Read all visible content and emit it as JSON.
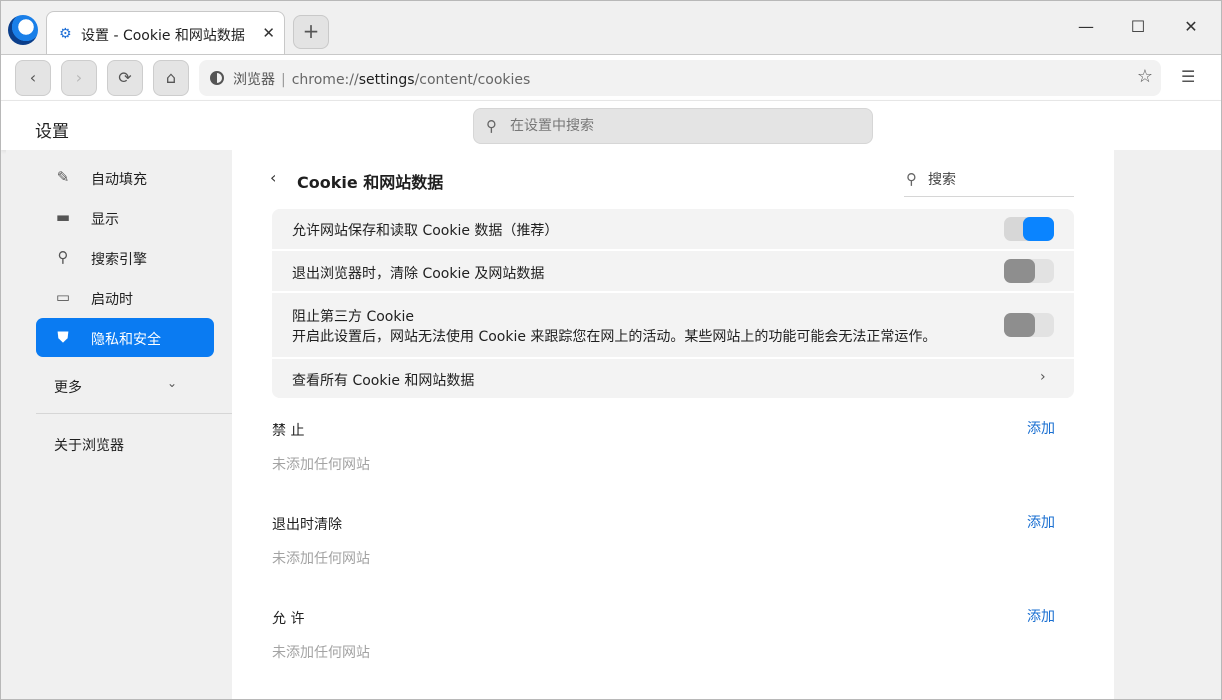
{
  "tab": {
    "title": "设置 - Cookie 和网站数据",
    "close": "✕"
  },
  "new_tab_label": "+",
  "window_controls": {
    "minimize": "—",
    "maximize": "☐",
    "close": "✕"
  },
  "toolbar": {
    "back": "‹",
    "forward": "›",
    "reload": "⟳",
    "home": "⌂",
    "omnibox": {
      "label": "浏览器",
      "separator": "|",
      "url_scheme": "chrome://",
      "url_host": "settings",
      "url_path": "/content/cookies"
    },
    "star": "☆",
    "menu": "☰"
  },
  "settings": {
    "title": "设置",
    "search_placeholder": "在设置中搜索"
  },
  "sidebar": {
    "items": [
      {
        "label": "自动填充",
        "icon": "pencil-icon",
        "glyph": "✎"
      },
      {
        "label": "显示",
        "icon": "monitor-icon",
        "glyph": "▬"
      },
      {
        "label": "搜索引擎",
        "icon": "search-icon",
        "glyph": "⚲"
      },
      {
        "label": "启动时",
        "icon": "window-icon",
        "glyph": "▭"
      },
      {
        "label": "隐私和安全",
        "icon": "shield-icon",
        "glyph": "⛊",
        "active": true
      }
    ],
    "more": "更多",
    "more_chevron": "⌄",
    "about": "关于浏览器"
  },
  "page": {
    "back": "‹",
    "title": "Cookie 和网站数据",
    "search_placeholder": "搜索",
    "rows": [
      {
        "label": "允许网站保存和读取 Cookie 数据（推荐）",
        "toggle": true
      },
      {
        "label": "退出浏览器时，清除 Cookie 及网站数据",
        "toggle": false
      },
      {
        "label": "阻止第三方 Cookie",
        "sub": "开启此设置后，网站无法使用 Cookie 来跟踪您在网上的活动。某些网站上的功能可能会无法正常运作。",
        "toggle": false
      },
      {
        "label": "查看所有 Cookie 和网站数据",
        "chevron": "›"
      }
    ],
    "sections": [
      {
        "title": "禁 止",
        "add": "添加",
        "empty": "未添加任何网站"
      },
      {
        "title": "退出时清除",
        "add": "添加",
        "empty": "未添加任何网站"
      },
      {
        "title": "允 许",
        "add": "添加",
        "empty": "未添加任何网站"
      }
    ]
  },
  "colors": {
    "accent": "#0a84ff",
    "active_nav": "#0a7bf2",
    "link": "#1a6fd1"
  }
}
